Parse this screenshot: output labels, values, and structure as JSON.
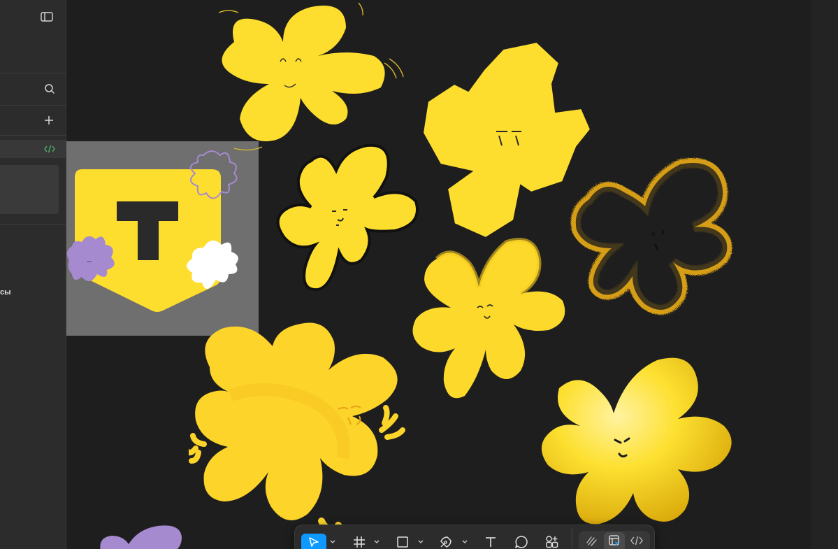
{
  "left_panel": {
    "cut_label": "сы",
    "icons": {
      "panel_toggle": "sidebar-toggle-icon",
      "search": "search-icon",
      "add": "plus-icon",
      "code": "code-icon"
    },
    "code_icon_color": "#4caf6a"
  },
  "canvas": {
    "background": "#1e1e1e",
    "selection_fill": "#6f6f6f",
    "brand_yellow": "#fddd2d",
    "logo_letter": "T",
    "accent_purple": "#a58ad0"
  },
  "toolbar": {
    "tools": [
      {
        "name": "move-tool",
        "icon": "cursor-arrow-icon",
        "active": true
      },
      {
        "name": "frame-tool",
        "icon": "hash-frame-icon"
      },
      {
        "name": "rectangle-tool",
        "icon": "square-icon"
      },
      {
        "name": "pen-tool",
        "icon": "pen-nib-icon"
      },
      {
        "name": "text-tool",
        "icon": "text-t-icon"
      },
      {
        "name": "comment-tool",
        "icon": "speech-bubble-icon"
      },
      {
        "name": "actions-tool",
        "icon": "plugins-grid-icon"
      }
    ],
    "modes": [
      {
        "name": "draw-mode",
        "icon": "scribble-icon"
      },
      {
        "name": "design-mode",
        "icon": "design-layout-icon",
        "active": true
      },
      {
        "name": "dev-mode",
        "icon": "code-brackets-icon"
      }
    ],
    "accent": "#0d99ff"
  }
}
